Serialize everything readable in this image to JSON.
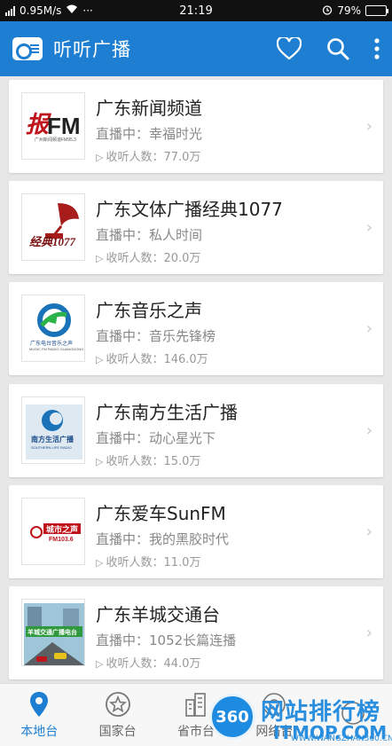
{
  "status_bar": {
    "network": "0.95M/s",
    "more": "···",
    "time": "21:19",
    "battery": "79%",
    "battery_level": 0.79
  },
  "header": {
    "title": "听听广播",
    "background": "#1e7fd2"
  },
  "stations": [
    {
      "name": "广东新闻频道",
      "now_playing": "直播中：幸福时光",
      "listeners": "收听人数：77.0万",
      "logo_text": "FM",
      "logo_caption": "广州新闻频道FM95.3",
      "logo_icon": "news-fm-logo-icon"
    },
    {
      "name": "广东文体广播经典1077",
      "now_playing": "直播中：私人时间",
      "listeners": "收听人数：20.0万",
      "logo_text": "经典1077",
      "logo_icon": "gramophone-logo-icon"
    },
    {
      "name": "广东音乐之声",
      "now_playing": "直播中：音乐先锋榜",
      "listeners": "收听人数：146.0万",
      "logo_text": "广东电台音乐之声",
      "logo_caption": "MUSIC FM RADIO GUANGDONG",
      "logo_icon": "music-swirl-logo-icon"
    },
    {
      "name": "广东南方生活广播",
      "now_playing": "直播中：动心星光下",
      "listeners": "收听人数：15.0万",
      "logo_text": "南方生活广播",
      "logo_caption": "SOUTHERN LIFE RADIO",
      "logo_icon": "southern-life-logo-icon"
    },
    {
      "name": "广东爱车SunFM",
      "now_playing": "直播中：我的黑胶时代",
      "listeners": "收听人数：11.0万",
      "logo_text": "城市之声",
      "logo_caption": "FM103.6",
      "logo_icon": "city-voice-logo-icon"
    },
    {
      "name": "广东羊城交通台",
      "now_playing": "直播中：1052长篇连播",
      "listeners": "收听人数：44.0万",
      "logo_text": "羊城交通广播电台",
      "logo_icon": "traffic-radio-logo-icon"
    }
  ],
  "bottom_nav": [
    {
      "label": "本地台",
      "icon": "location-pin-icon",
      "active": true
    },
    {
      "label": "国家台",
      "icon": "star-circle-icon",
      "active": false
    },
    {
      "label": "省市台",
      "icon": "buildings-icon",
      "active": false
    },
    {
      "label": "网络台",
      "icon": "network-icon",
      "active": false
    },
    {
      "label": "",
      "icon": "more-tab-icon",
      "active": false
    }
  ],
  "watermark": {
    "badge": "360",
    "title": "网站排行榜",
    "site": "ITMOP.COM",
    "sub": "WWW.WANGZHAN360.CN"
  }
}
